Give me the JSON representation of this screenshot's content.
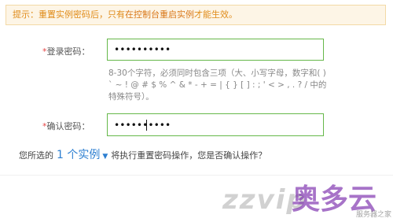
{
  "notice": {
    "prefix": "提示：重置实例密码后，只有",
    "emphasis": "在控制台重启实例",
    "suffix": "才能生效。"
  },
  "form": {
    "password": {
      "required_mark": "*",
      "label": "登录密码：",
      "value": "••••••••••"
    },
    "hint": "8-30个字符，必须同时包含三项（大、小写字母，数字和( ) ` ~ ! @ # $ % ^ & * - + = | { } [ ] : ; ' < > , . ? / 中的特殊符号）。",
    "confirm": {
      "required_mark": "*",
      "label": "确认密码：",
      "value": "••••••••••"
    }
  },
  "summary": {
    "before": "您所选的",
    "count_link": "1 个实例",
    "after": "将执行重置密码操作，您是否确认操作？"
  },
  "watermark": {
    "latin": "zzvip",
    "brand": "奥多云",
    "site": "服务器之家"
  },
  "colors": {
    "field_border": "#66b84a",
    "notice_bg": "#fdf5e6",
    "link": "#2d7fd1",
    "required": "#e64545"
  }
}
